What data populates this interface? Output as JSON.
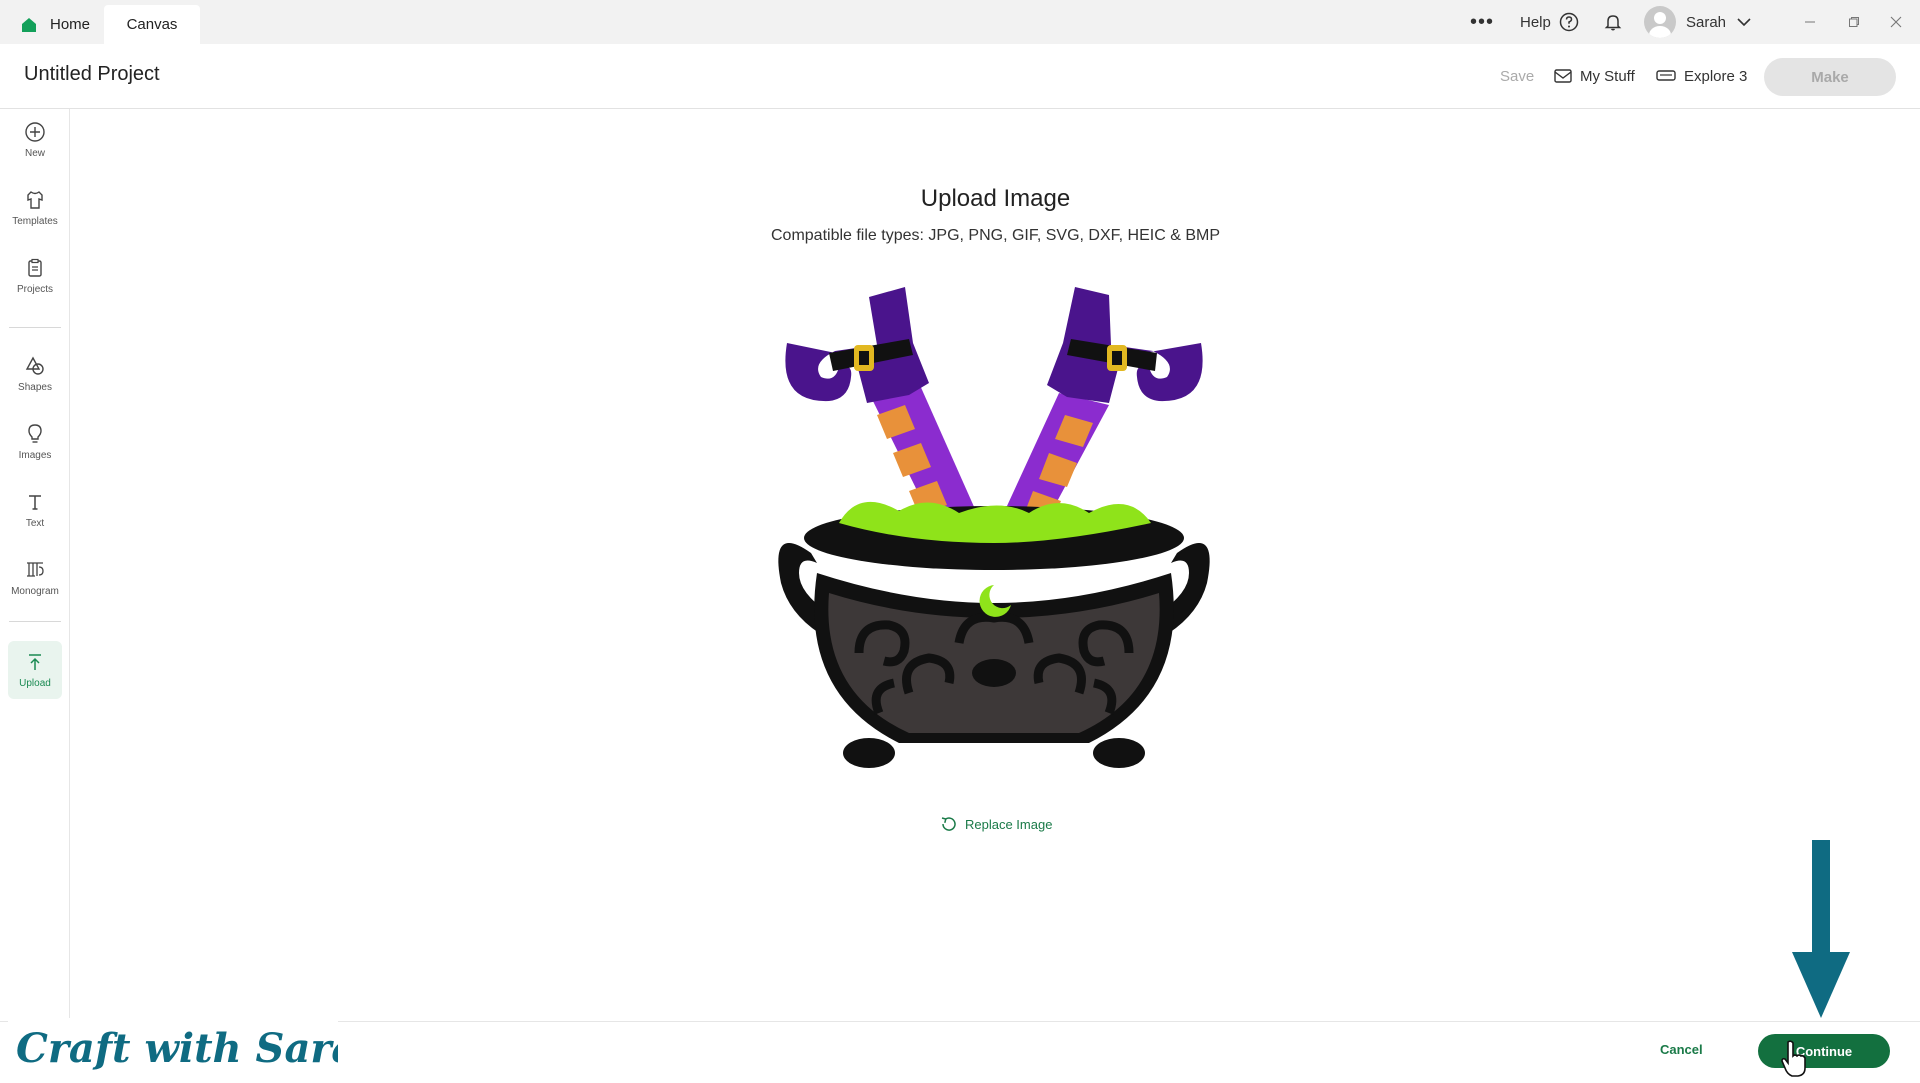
{
  "titlebar": {
    "tabs": [
      {
        "label": "Home",
        "icon": "home-icon"
      },
      {
        "label": "Canvas"
      }
    ],
    "more_label": "•••",
    "help_label": "Help",
    "user_name": "Sarah",
    "window_controls": [
      "minimize-icon",
      "restore-icon",
      "close-icon"
    ]
  },
  "header": {
    "project_title": "Untitled Project",
    "save_label": "Save",
    "mystuff_label": "My Stuff",
    "machine_label": "Explore 3",
    "make_label": "Make"
  },
  "sidebar": {
    "items": [
      {
        "label": "New",
        "icon": "plus-circle-icon"
      },
      {
        "label": "Templates",
        "icon": "shirt-icon"
      },
      {
        "label": "Projects",
        "icon": "clipboard-icon"
      },
      {
        "label": "Shapes",
        "icon": "shapes-icon"
      },
      {
        "label": "Images",
        "icon": "lightbulb-icon"
      },
      {
        "label": "Text",
        "icon": "text-icon"
      },
      {
        "label": "Monogram",
        "icon": "monogram-icon"
      },
      {
        "label": "Upload",
        "icon": "upload-icon",
        "active": true
      }
    ]
  },
  "main": {
    "title": "Upload Image",
    "file_types": "Compatible file types:  JPG, PNG, GIF, SVG, DXF, HEIC & BMP",
    "replace_label": "Replace Image"
  },
  "footer": {
    "cancel_label": "Cancel",
    "continue_label": "Continue"
  },
  "overlay": {
    "watermark_text": "Craft with Sarah",
    "arrow_color": "#0f6b82"
  },
  "colors": {
    "accent_green": "#13703f",
    "link_green": "#1a7a48",
    "purple": "#5a1a8c",
    "slime": "#8fe31a",
    "stripe_orange": "#e8913a"
  }
}
